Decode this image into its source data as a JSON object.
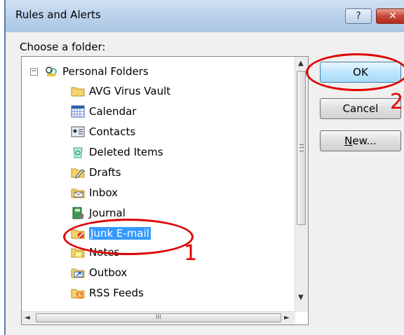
{
  "window": {
    "title": "Rules and Alerts",
    "help_label": "?",
    "close_label": "✕"
  },
  "prompt": "Choose a folder:",
  "tree": {
    "root": "Personal Folders",
    "expander": "−",
    "items": [
      {
        "label": "AVG Virus Vault",
        "icon": "folder-icon"
      },
      {
        "label": "Calendar",
        "icon": "calendar-icon"
      },
      {
        "label": "Contacts",
        "icon": "contacts-icon"
      },
      {
        "label": "Deleted Items",
        "icon": "recycle-icon"
      },
      {
        "label": "Drafts",
        "icon": "drafts-icon"
      },
      {
        "label": "Inbox",
        "icon": "inbox-icon"
      },
      {
        "label": "Journal",
        "icon": "journal-icon"
      },
      {
        "label": "Junk E-mail",
        "icon": "junk-email-icon",
        "selected": true
      },
      {
        "label": "Notes",
        "icon": "notes-icon"
      },
      {
        "label": "Outbox",
        "icon": "outbox-icon"
      },
      {
        "label": "RSS Feeds",
        "icon": "rss-icon"
      }
    ]
  },
  "scroll": {
    "up": "▲",
    "down": "▼",
    "left": "◄",
    "right": "►",
    "hgrip": "III"
  },
  "buttons": {
    "ok": "OK",
    "cancel": "Cancel",
    "new_u": "N",
    "new_rest": "ew..."
  },
  "annotations": {
    "step1": "1",
    "step2": "2",
    "color": "#e00000"
  }
}
